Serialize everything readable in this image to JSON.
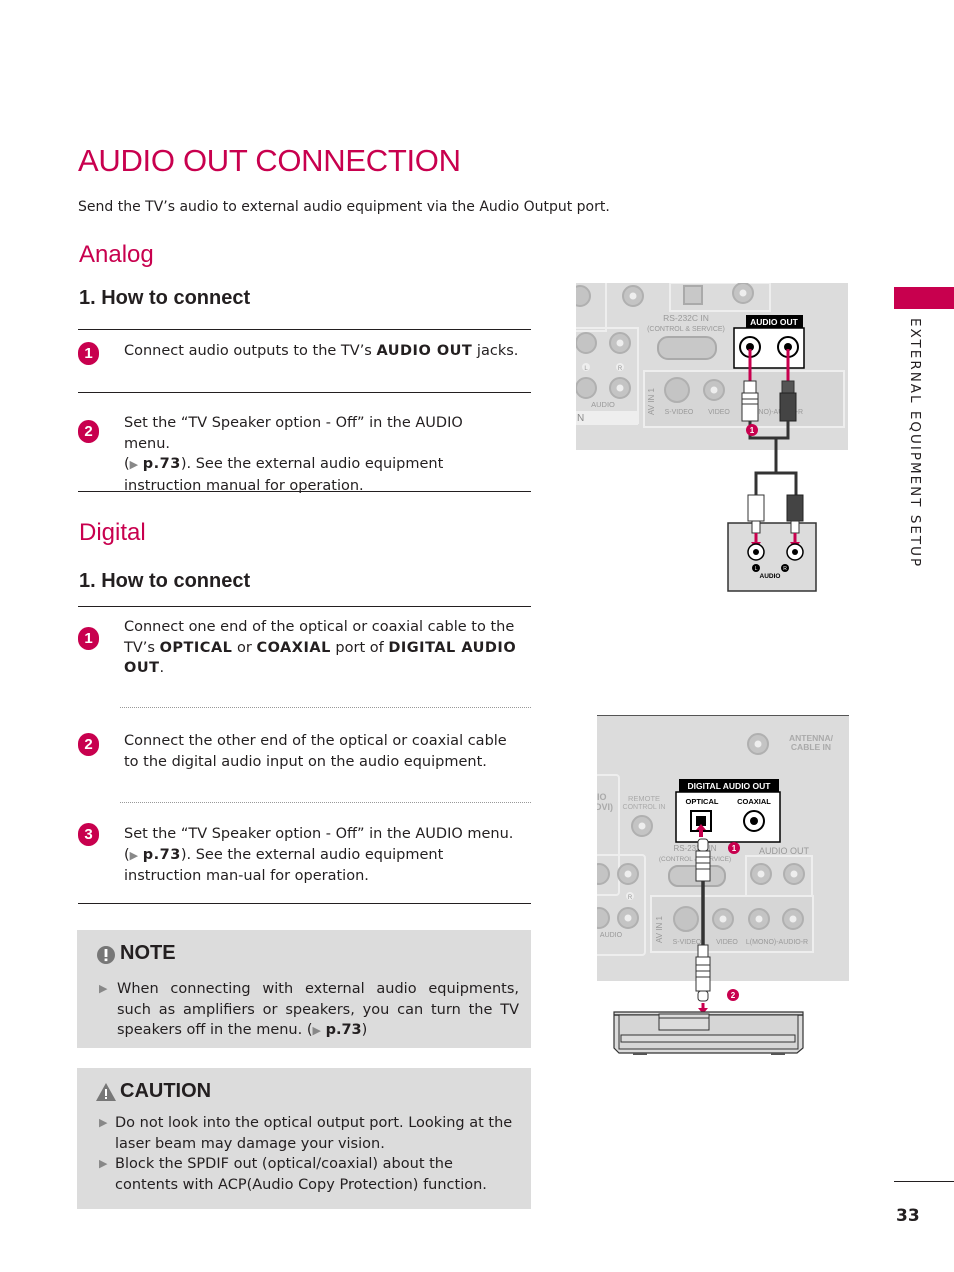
{
  "page": {
    "title": "AUDIO OUT CONNECTION",
    "intro": "Send the TV’s audio to external audio equipment via the Audio Output port.",
    "side_label": "EXTERNAL EQUIPMENT SETUP",
    "page_number": "33",
    "accent_color": "#c8004e"
  },
  "analog": {
    "heading": "Analog",
    "subheading": "1. How to connect",
    "steps": [
      {
        "num": "1",
        "pre": "Connect audio outputs to the TV’s ",
        "bold": "AUDIO OUT",
        "post": " jacks."
      },
      {
        "num": "2",
        "line1": "Set the “TV Speaker option - Off” in the AUDIO menu.",
        "ref_open": "(",
        "ref": "p.73",
        "post": "). See the external audio equipment instruction manual for operation."
      }
    ]
  },
  "digital": {
    "heading": "Digital",
    "subheading": "1. How to connect",
    "steps": [
      {
        "num": "1",
        "pre": "Connect one end of the optical or coaxial cable to the TV’s ",
        "b1": "OPTICAL",
        "mid1": " or ",
        "b2": "COAXIAL",
        "mid2": " port of ",
        "b3": "DIGITAL AUDIO OUT",
        "post": "."
      },
      {
        "num": "2",
        "text": "Connect the other end of the optical or coaxial cable to the digital audio input on the audio equipment."
      },
      {
        "num": "3",
        "pre": "Set the “TV Speaker option - Off” in the AUDIO menu. (",
        "ref": "p.73",
        "post": "). See the external audio equipment instruction man-ual for operation."
      }
    ]
  },
  "note": {
    "icon": "exclamation-circle-icon",
    "heading": "NOTE",
    "items": [
      {
        "pre": "When connecting with external audio equipments, such as amplifiers or speakers, you can turn the TV speakers off in the menu.  (",
        "ref": "p.73",
        "post": ")"
      }
    ]
  },
  "caution": {
    "icon": "warning-triangle-icon",
    "heading": "CAUTION",
    "items": [
      "Do not look into the optical output port. Looking at the laser beam may damage your vision.",
      "Block the SPDIF out (optical/coaxial) about the contents with ACP(Audio Copy Protection) function."
    ]
  },
  "diagram_analog": {
    "audio_out_label": "AUDIO OUT",
    "rs232_label": "RS-232C IN",
    "rs232_sub": "(CONTROL & SERVICE)",
    "av_in_label": "AV IN 1",
    "svideo_label": "S-VIDEO",
    "video_label": "VIDEO",
    "audio_lr_label": "L(MONO)-AUDIO-R",
    "left_audio_label": "AUDIO",
    "l_label": "L",
    "r_label": "R",
    "in_label": "N",
    "step_marker": "1",
    "device_audio_label": "AUDIO",
    "device_l": "L",
    "device_r": "R"
  },
  "diagram_digital": {
    "antenna_label_1": "ANTENNA/",
    "antenna_label_2": "CABLE IN",
    "digital_audio_out_label": "DIGITAL AUDIO OUT",
    "optical_label": "OPTICAL",
    "coaxial_label": "COAXIAL",
    "remote_label_1": "REMOTE",
    "remote_label_2": "CONTROL IN",
    "partial_label_1": "IO",
    "partial_label_2": "DVI)",
    "rs232_label": "RS-232C IN",
    "rs232_sub": "(CONTROL & SERVICE)",
    "audio_out_label": "AUDIO OUT",
    "av_in_label": "AV IN 1",
    "svideo_label": "S-VIDEO",
    "video_label": "VIDEO",
    "audio_lr_label": "L(MONO)-AUDIO-R",
    "left_audio_label": "AUDIO",
    "r_label": "R",
    "step_marker_1": "1",
    "step_marker_2": "2"
  }
}
